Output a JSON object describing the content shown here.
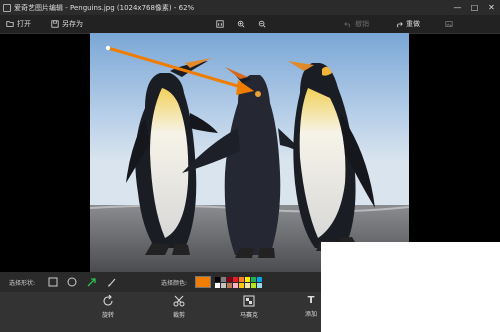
{
  "window": {
    "title": "爱奇艺图片编辑 - Penguins.jpg (1024x768像素) - 62%",
    "controls": [
      "—",
      "□",
      "✕"
    ]
  },
  "toolbar": {
    "open_label": "打开",
    "save_as_label": "另存为",
    "undo_label": "撤销",
    "redo_label": "重做",
    "accent": "#f07d00"
  },
  "shapebar": {
    "shape_label": "选择形状:",
    "color_label": "选择颜色:",
    "selected_color": "#f07d00",
    "palette": [
      "#000000",
      "#7f7f7f",
      "#880015",
      "#ed1c24",
      "#ff7f27",
      "#fff200",
      "#22b14c",
      "#00a2e8",
      "#ffffff",
      "#c3c3c3",
      "#b97a57",
      "#ffaec9",
      "#ffc90e",
      "#efe4b0",
      "#b5e61d",
      "#99d9ea"
    ]
  },
  "bottombar": {
    "rotate_label": "旋转",
    "crop_label": "裁剪",
    "mosaic_label": "马赛克",
    "add_label": "添加"
  },
  "image": {
    "alt": "Penguins"
  }
}
